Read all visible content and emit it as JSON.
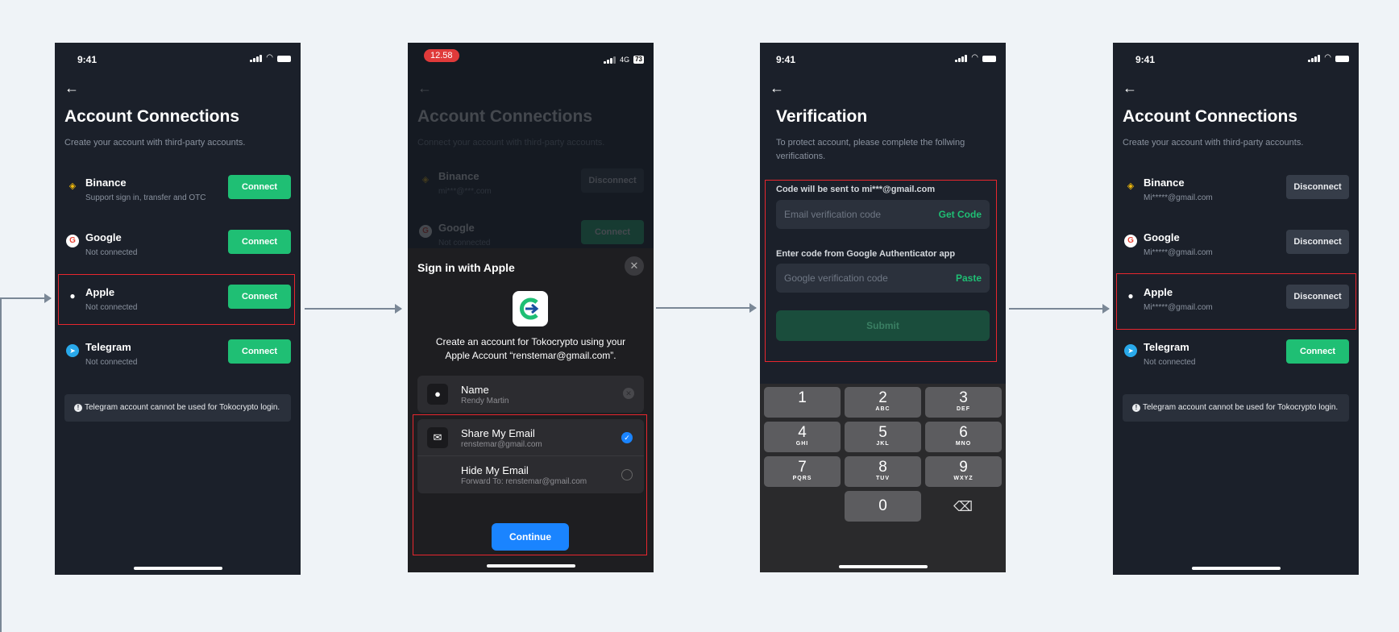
{
  "screen1": {
    "time": "9:41",
    "title": "Account Connections",
    "subtitle": "Create your account with third-party accounts.",
    "rows": [
      {
        "name": "Binance",
        "sub": "Support sign in, transfer and OTC",
        "action": "Connect"
      },
      {
        "name": "Google",
        "sub": "Not connected",
        "action": "Connect"
      },
      {
        "name": "Apple",
        "sub": "Not connected",
        "action": "Connect"
      },
      {
        "name": "Telegram",
        "sub": "Not connected",
        "action": "Connect"
      }
    ],
    "notice": "Telegram account cannot be used for Tokocrypto login."
  },
  "screen2": {
    "time": "12.58",
    "network": "4G",
    "battery": "73",
    "bg_title": "Account Connections",
    "bg_subtitle": "Connect your account with third-party accounts.",
    "bg_rows": [
      {
        "name": "Binance",
        "sub": "mi***@***.com",
        "action": "Disconnect"
      },
      {
        "name": "Google",
        "sub": "Not connected",
        "action": "Connect"
      }
    ],
    "sheet": {
      "title": "Sign in with Apple",
      "description": "Create an account for Tokocrypto using your Apple Account “renstemar@gmail.com”.",
      "name_label": "Name",
      "name_value": "Rendy Martin",
      "share_label": "Share My Email",
      "share_value": "renstemar@gmail.com",
      "hide_label": "Hide My Email",
      "hide_value": "Forward To: renstemar@gmail.com",
      "continue": "Continue"
    }
  },
  "screen3": {
    "time": "9:41",
    "title": "Verification",
    "subtitle": "To protect account, please complete the follwing verifications.",
    "email_label": "Code will be sent to mi***@gmail.com",
    "email_placeholder": "Email verification code",
    "email_action": "Get Code",
    "google_label": "Enter code from Google Authenticator app",
    "google_placeholder": "Google verification code",
    "google_action": "Paste",
    "submit": "Submit",
    "keys": [
      {
        "num": "1",
        "letters": ""
      },
      {
        "num": "2",
        "letters": "ABC"
      },
      {
        "num": "3",
        "letters": "DEF"
      },
      {
        "num": "4",
        "letters": "GHI"
      },
      {
        "num": "5",
        "letters": "JKL"
      },
      {
        "num": "6",
        "letters": "MNO"
      },
      {
        "num": "7",
        "letters": "PQRS"
      },
      {
        "num": "8",
        "letters": "TUV"
      },
      {
        "num": "9",
        "letters": "WXYZ"
      },
      {
        "num": "0",
        "letters": ""
      }
    ]
  },
  "screen4": {
    "time": "9:41",
    "title": "Account Connections",
    "subtitle": "Create your account with third-party accounts.",
    "rows": [
      {
        "name": "Binance",
        "sub": "Mi*****@gmail.com",
        "action": "Disconnect"
      },
      {
        "name": "Google",
        "sub": "Mi*****@gmail.com",
        "action": "Disconnect"
      },
      {
        "name": "Apple",
        "sub": "Mi*****@gmail.com",
        "action": "Disconnect"
      },
      {
        "name": "Telegram",
        "sub": "Not connected",
        "action": "Connect"
      }
    ],
    "notice": "Telegram account cannot be used for Tokocrypto login."
  },
  "colors": {
    "page_bg": "#eff3f7",
    "phone_bg": "#1b202a",
    "accent_green": "#1fbf74",
    "apple_blue": "#1a84ff",
    "highlight_red": "#e8262e",
    "connector_gray": "#7a8796"
  },
  "icons": {
    "binance": "binance-icon",
    "google": "google-icon",
    "apple": "apple-icon",
    "telegram": "telegram-icon",
    "back": "arrow-left-icon",
    "close": "close-icon",
    "person": "person-icon",
    "mail": "mail-icon",
    "backspace": "backspace-icon"
  }
}
